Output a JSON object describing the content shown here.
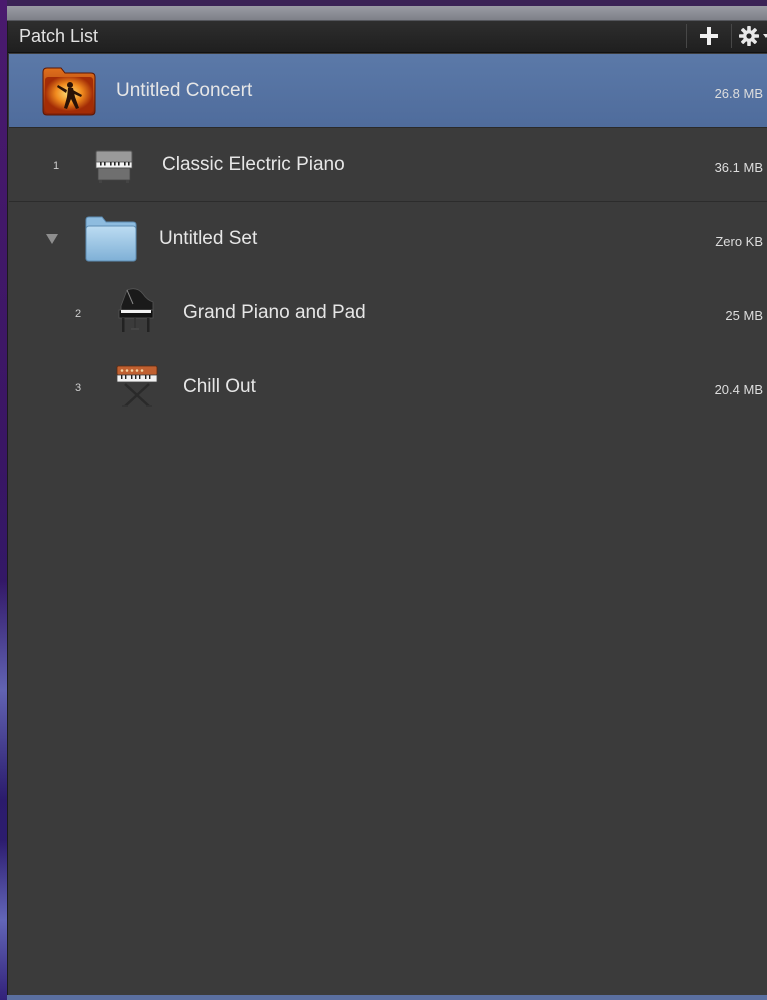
{
  "panel": {
    "title": "Patch List",
    "add_button": "add-icon",
    "settings_button": "gear-icon"
  },
  "concert": {
    "name": "Untitled Concert",
    "size": "26.8 MB",
    "icon": "concert-folder-icon"
  },
  "patches": [
    {
      "number": "1",
      "name": "Classic Electric Piano",
      "size": "36.1 MB",
      "icon": "electric-piano-icon"
    },
    {
      "number": "2",
      "name": "Grand Piano and Pad",
      "size": "25 MB",
      "icon": "grand-piano-icon"
    },
    {
      "number": "3",
      "name": "Chill Out",
      "size": "20.4 MB",
      "icon": "synthesizer-icon"
    }
  ],
  "set": {
    "name": "Untitled Set",
    "size": "Zero KB",
    "icon": "folder-icon",
    "expanded": true
  },
  "colors": {
    "panel_bg": "#3b3b3b",
    "selection": "#5574a4",
    "header_bg": "#262626",
    "text": "#e6e6e6"
  }
}
